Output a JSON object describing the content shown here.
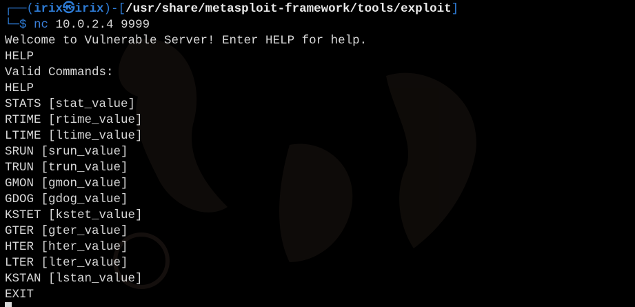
{
  "prompt": {
    "tree_top": "┌──(",
    "user": "irix",
    "at_symbol": "㉿",
    "host": "irix",
    "sep_open": ")-[",
    "cwd": "/usr/share/metasploit-framework/tools/exploit",
    "sep_close": "]",
    "tree_bottom": "└─",
    "dollar": "$ ",
    "command": "nc",
    "args": " 10.0.2.4 9999"
  },
  "output": [
    "Welcome to Vulnerable Server! Enter HELP for help.",
    "HELP",
    "Valid Commands:",
    "HELP",
    "STATS [stat_value]",
    "RTIME [rtime_value]",
    "LTIME [ltime_value]",
    "SRUN [srun_value]",
    "TRUN [trun_value]",
    "GMON [gmon_value]",
    "GDOG [gdog_value]",
    "KSTET [kstet_value]",
    "GTER [gter_value]",
    "HTER [hter_value]",
    "LTER [lter_value]",
    "KSTAN [lstan_value]",
    "EXIT"
  ],
  "colors": {
    "background": "#000000",
    "prompt_frame": "#2e7cd6",
    "prompt_path_bracket": "#3bbf5c",
    "command": "#3b7fd9",
    "text": "#d8d8d8"
  }
}
